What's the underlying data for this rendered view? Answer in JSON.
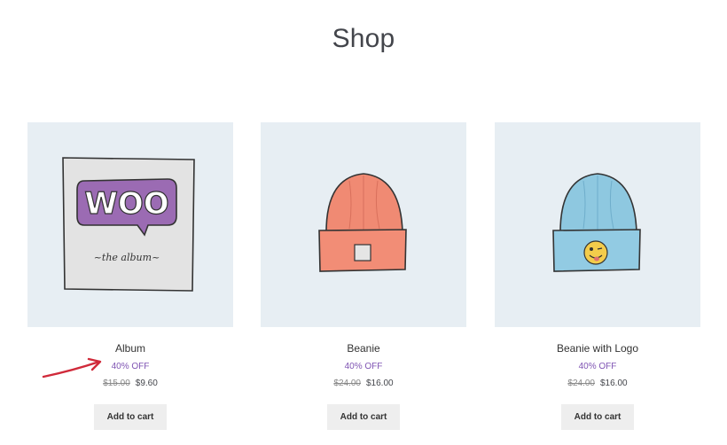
{
  "page": {
    "title": "Shop"
  },
  "products": [
    {
      "name": "Album",
      "discount": "40% OFF",
      "old_price": "$15.00",
      "price": "$9.60",
      "cta": "Add to cart",
      "image": {
        "logo_text": "WOO",
        "subtitle": "~the album~",
        "color": "#9b6bb3"
      }
    },
    {
      "name": "Beanie",
      "discount": "40% OFF",
      "old_price": "$24.00",
      "price": "$16.00",
      "cta": "Add to cart",
      "image": {
        "color": "#f08a73"
      }
    },
    {
      "name": "Beanie with Logo",
      "discount": "40% OFF",
      "old_price": "$24.00",
      "price": "$16.00",
      "cta": "Add to cart",
      "image": {
        "color": "#8ec8e0"
      }
    }
  ],
  "colors": {
    "accent": "#7f54b3",
    "annotation_arrow": "#d02a3a",
    "image_background": "#e7eef3"
  },
  "icons": {
    "annotation": "arrow-right-icon"
  }
}
